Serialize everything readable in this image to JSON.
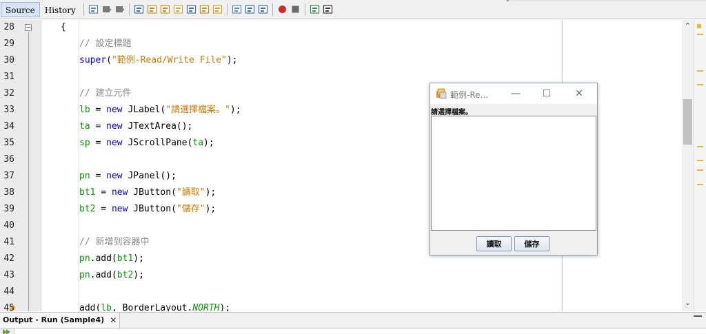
{
  "editor_tabs": [
    {
      "label": "Source",
      "active": true
    },
    {
      "label": "History",
      "active": false
    }
  ],
  "toolbar_icons": [
    "last-edit-icon",
    "back-icon",
    "forward-icon",
    "find-selection-icon",
    "find-previous-icon",
    "find-next-icon",
    "toggle-highlight-icon",
    "toggle-rectangular-icon",
    "previous-bookmark-icon",
    "next-bookmark-icon",
    "toggle-bookmark-icon",
    "shift-left-icon",
    "shift-right-icon",
    "start-macro-icon",
    "stop-macro-icon",
    "comment-icon",
    "uncomment-icon"
  ],
  "code_lines": [
    {
      "number": "28",
      "indent": 3,
      "tokens": [
        {
          "t": "{",
          "c": ""
        }
      ]
    },
    {
      "number": "29",
      "indent": 4,
      "tokens": [
        {
          "t": "// 設定標題",
          "c": "cmt"
        }
      ]
    },
    {
      "number": "30",
      "indent": 4,
      "tokens": [
        {
          "t": "super",
          "c": "kw"
        },
        {
          "t": "(",
          "c": ""
        },
        {
          "t": "\"範例-Read/Write File\"",
          "c": "str"
        },
        {
          "t": ");",
          "c": ""
        }
      ]
    },
    {
      "number": "31",
      "indent": 0,
      "tokens": []
    },
    {
      "number": "32",
      "indent": 4,
      "tokens": [
        {
          "t": "// 建立元件",
          "c": "cmt"
        }
      ]
    },
    {
      "number": "33",
      "indent": 4,
      "tokens": [
        {
          "t": "lb",
          "c": "hl"
        },
        {
          "t": " = ",
          "c": ""
        },
        {
          "t": "new",
          "c": "kw"
        },
        {
          "t": " JLabel(",
          "c": ""
        },
        {
          "t": "\"請選擇檔案。\"",
          "c": "str"
        },
        {
          "t": ");",
          "c": ""
        }
      ]
    },
    {
      "number": "34",
      "indent": 4,
      "tokens": [
        {
          "t": "ta",
          "c": "hl"
        },
        {
          "t": " = ",
          "c": ""
        },
        {
          "t": "new",
          "c": "kw"
        },
        {
          "t": " JTextArea();",
          "c": ""
        }
      ]
    },
    {
      "number": "35",
      "indent": 4,
      "tokens": [
        {
          "t": "sp",
          "c": "hl"
        },
        {
          "t": " = ",
          "c": ""
        },
        {
          "t": "new",
          "c": "kw"
        },
        {
          "t": " JScrollPane(",
          "c": ""
        },
        {
          "t": "ta",
          "c": "hl"
        },
        {
          "t": ");",
          "c": ""
        }
      ]
    },
    {
      "number": "36",
      "indent": 0,
      "tokens": []
    },
    {
      "number": "37",
      "indent": 4,
      "tokens": [
        {
          "t": "pn",
          "c": "hl"
        },
        {
          "t": " = ",
          "c": ""
        },
        {
          "t": "new",
          "c": "kw"
        },
        {
          "t": " JPanel();",
          "c": ""
        }
      ]
    },
    {
      "number": "38",
      "indent": 4,
      "tokens": [
        {
          "t": "bt1",
          "c": "hl"
        },
        {
          "t": " = ",
          "c": ""
        },
        {
          "t": "new",
          "c": "kw"
        },
        {
          "t": " JButton(",
          "c": ""
        },
        {
          "t": "\"讀取\"",
          "c": "str"
        },
        {
          "t": ");",
          "c": ""
        }
      ]
    },
    {
      "number": "39",
      "indent": 4,
      "tokens": [
        {
          "t": "bt2",
          "c": "hl"
        },
        {
          "t": " = ",
          "c": ""
        },
        {
          "t": "new",
          "c": "kw"
        },
        {
          "t": " JButton(",
          "c": ""
        },
        {
          "t": "\"儲存\"",
          "c": "str"
        },
        {
          "t": ");",
          "c": ""
        }
      ]
    },
    {
      "number": "40",
      "indent": 0,
      "tokens": []
    },
    {
      "number": "41",
      "indent": 4,
      "tokens": [
        {
          "t": "// 新增到容器中",
          "c": "cmt"
        }
      ]
    },
    {
      "number": "42",
      "indent": 4,
      "tokens": [
        {
          "t": "pn",
          "c": "hl"
        },
        {
          "t": ".add(",
          "c": ""
        },
        {
          "t": "bt1",
          "c": "hl"
        },
        {
          "t": ");",
          "c": ""
        }
      ]
    },
    {
      "number": "43",
      "indent": 4,
      "tokens": [
        {
          "t": "pn",
          "c": "hl"
        },
        {
          "t": ".add(",
          "c": ""
        },
        {
          "t": "bt2",
          "c": "hl"
        },
        {
          "t": ");",
          "c": ""
        }
      ]
    },
    {
      "number": "44",
      "indent": 0,
      "tokens": []
    },
    {
      "number": "45",
      "indent": 4,
      "tokens": [
        {
          "t": "add(",
          "c": ""
        },
        {
          "t": "lb",
          "c": "hl"
        },
        {
          "t": ", BorderLayout.",
          "c": ""
        },
        {
          "t": "NORTH",
          "c": "fld"
        },
        {
          "t": ");",
          "c": ""
        }
      ]
    }
  ],
  "app_window": {
    "title": "範例-Re...",
    "minimize_glyph": "—",
    "maximize_glyph": "☐",
    "close_glyph": "✕",
    "label": "請選擇檔案。",
    "textarea_value": "",
    "read_button": "讀取",
    "save_button": "儲存"
  },
  "scrollbar": {
    "up_glyph": "⌃",
    "down_glyph": "⌄"
  },
  "output_panel": {
    "tab_title": "Output - Run (Sample4)",
    "close_glyph": "✕"
  },
  "colors": {
    "keyword": "#0000e6",
    "string": "#ce7b00",
    "comment": "#8a8a8a",
    "identifier": "#009900",
    "margin_line": "#f2b8b8",
    "active_tab": "#d8e6f7"
  }
}
